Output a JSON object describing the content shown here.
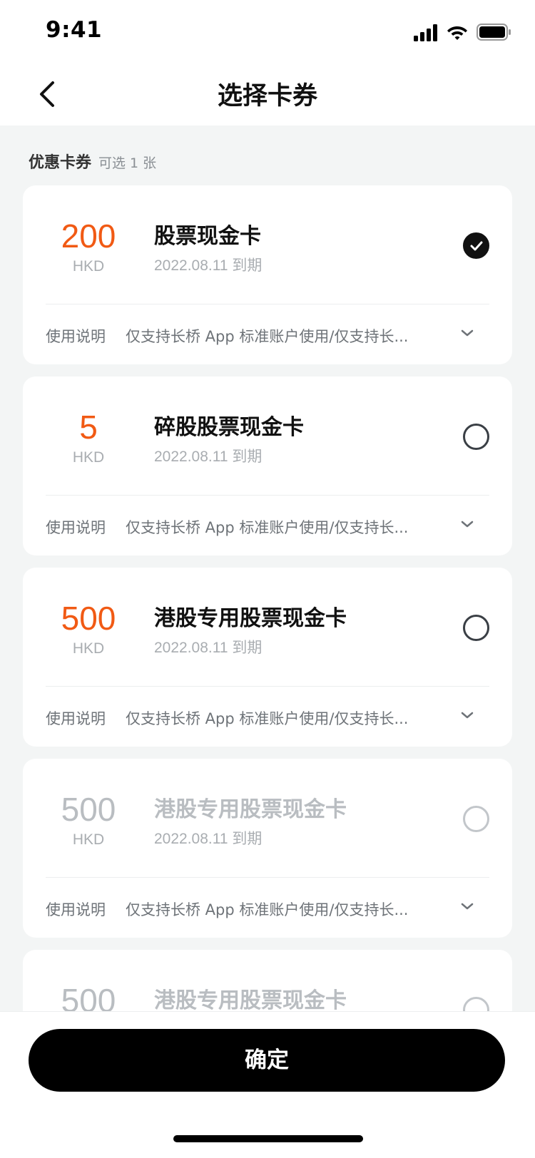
{
  "status_bar": {
    "time": "9:41"
  },
  "nav": {
    "title": "选择卡券"
  },
  "section": {
    "title": "优惠卡券",
    "subtitle": "可选 1 张"
  },
  "cards": [
    {
      "amount": "200",
      "currency": "HKD",
      "name": "股票现金卡",
      "expiry": "2022.08.11 到期",
      "usage_label": "使用说明",
      "usage_text": "仅支持长桥 App 标准账户使用/仅支持长...",
      "selected": true,
      "disabled": false
    },
    {
      "amount": "5",
      "currency": "HKD",
      "name": "碎股股票现金卡",
      "expiry": "2022.08.11 到期",
      "usage_label": "使用说明",
      "usage_text": "仅支持长桥 App 标准账户使用/仅支持长...",
      "selected": false,
      "disabled": false
    },
    {
      "amount": "500",
      "currency": "HKD",
      "name": "港股专用股票现金卡",
      "expiry": "2022.08.11 到期",
      "usage_label": "使用说明",
      "usage_text": "仅支持长桥 App 标准账户使用/仅支持长...",
      "selected": false,
      "disabled": false
    },
    {
      "amount": "500",
      "currency": "HKD",
      "name": "港股专用股票现金卡",
      "expiry": "2022.08.11 到期",
      "usage_label": "使用说明",
      "usage_text": "仅支持长桥 App 标准账户使用/仅支持长...",
      "selected": false,
      "disabled": true
    },
    {
      "amount": "500",
      "currency": "",
      "name": "港股专用股票现金卡",
      "expiry": "",
      "usage_label": "",
      "usage_text": "",
      "selected": false,
      "disabled": true
    }
  ],
  "footer": {
    "confirm_label": "确定"
  },
  "colors": {
    "accent": "#F15A14",
    "disabled": "#B9BDC1",
    "background": "#F3F5F5"
  }
}
